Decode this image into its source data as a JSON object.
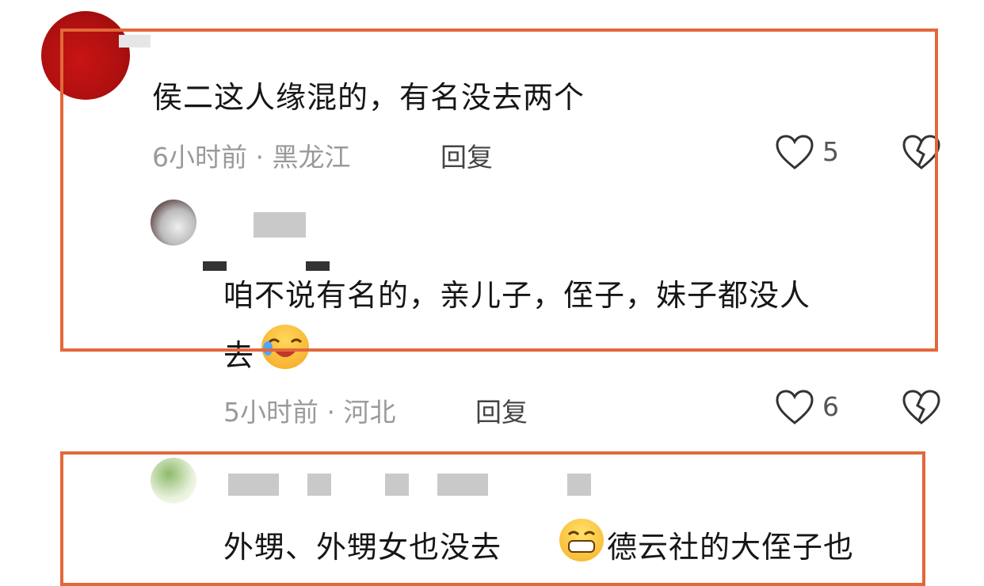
{
  "comments": [
    {
      "text": "侯二这人缘混的，有名没去两个",
      "meta": "6小时前 · 黑龙江",
      "reply_label": "回复",
      "likes": "5"
    },
    {
      "text_line1": "咱不说有名的，亲儿子，侄子，妹子都没人",
      "text_line2": "去",
      "meta": "5小时前 · 河北",
      "reply_label": "回复",
      "likes": "6"
    },
    {
      "text_part1": "外甥、外甥女也没去",
      "text_part2": "德云社的大侄子也"
    }
  ],
  "icons": [
    "heart-icon",
    "broken-heart-icon",
    "laughing-emoji-icon",
    "grinning-emoji-icon"
  ],
  "colors": {
    "highlight_frame": "#e2683a",
    "meta_text": "#9a9a9a"
  }
}
